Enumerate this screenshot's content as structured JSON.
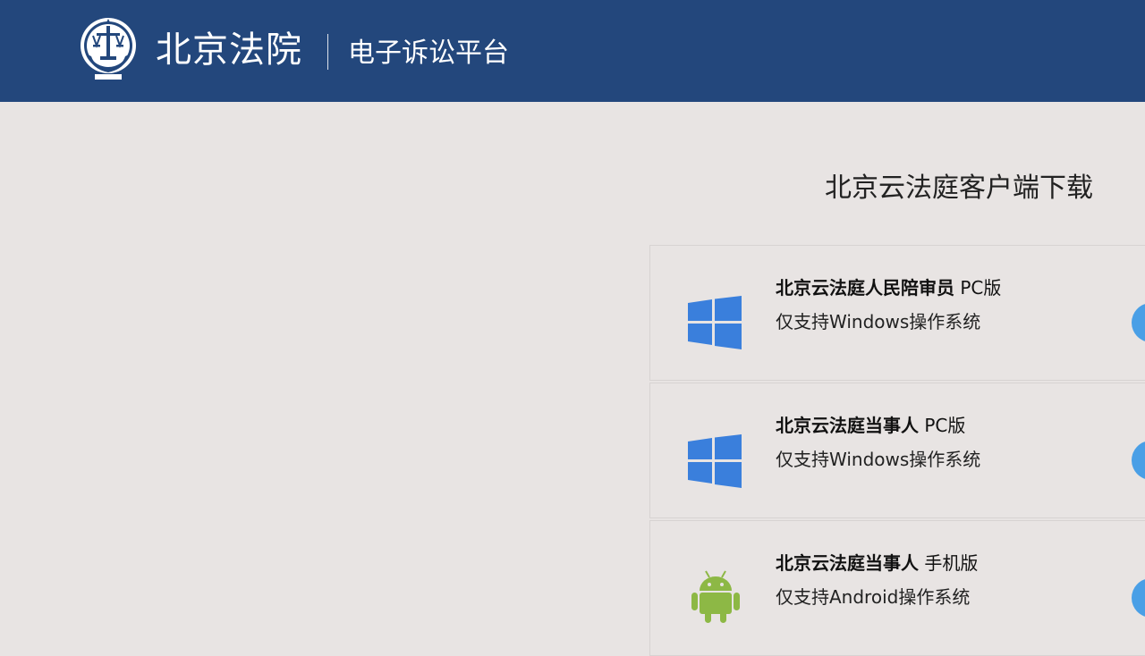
{
  "header": {
    "court_name": "北京法院",
    "platform_name": "电子诉讼平台",
    "logo_icon": "court-emblem-icon"
  },
  "main": {
    "section_title": "北京云法庭客户端下载",
    "downloads": [
      {
        "title_bold": "北京云法庭人民陪审员",
        "title_suffix": " PC版",
        "subtitle": "仅支持Windows操作系统",
        "icon": "windows-icon",
        "icon_color": "#3a7fdc"
      },
      {
        "title_bold": "北京云法庭当事人",
        "title_suffix": " PC版",
        "subtitle": "仅支持Windows操作系统",
        "icon": "windows-icon",
        "icon_color": "#3a7fdc"
      },
      {
        "title_bold": "北京云法庭当事人",
        "title_suffix": " 手机版",
        "subtitle": "仅支持Android操作系统",
        "icon": "android-icon",
        "icon_color": "#8db845"
      }
    ]
  },
  "colors": {
    "header_bg": "#23477c",
    "page_bg": "#e8e4e3",
    "download_button": "#4a9fe6"
  }
}
